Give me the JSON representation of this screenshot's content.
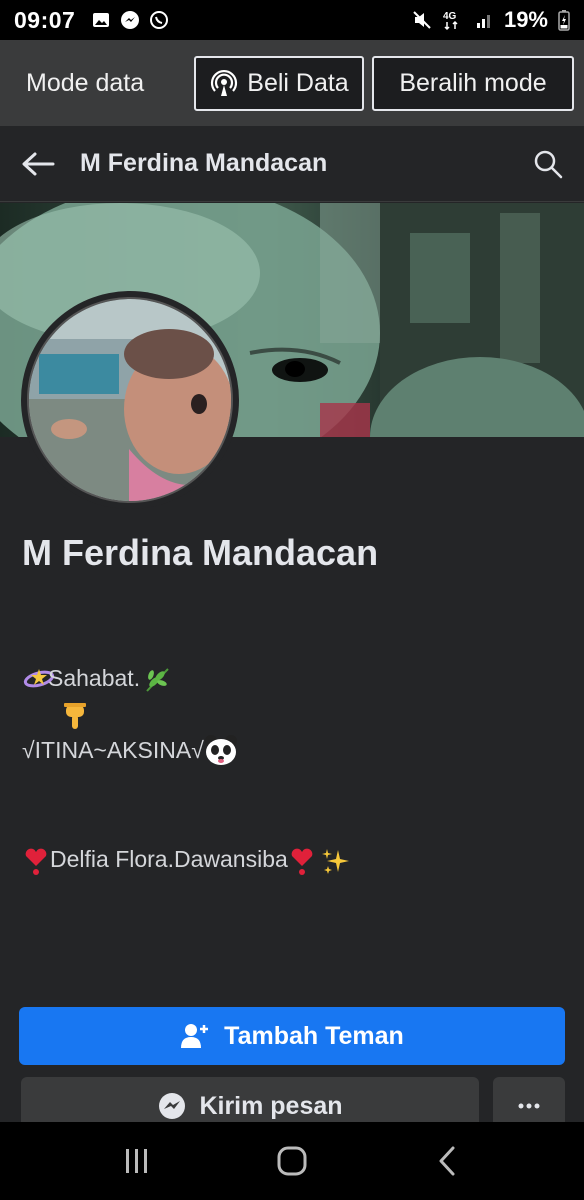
{
  "status_bar": {
    "time": "09:07",
    "battery": "19%",
    "network": "4G",
    "icons_left": [
      "image-icon",
      "messenger-icon",
      "whatsapp-icon"
    ],
    "icons_right": [
      "mute-icon",
      "network-4g-icon",
      "signal-icon",
      "battery-charging-icon"
    ]
  },
  "data_mode": {
    "label": "Mode data",
    "buy_button": "Beli Data",
    "switch_button": "Beralih mode"
  },
  "header": {
    "title": "M Ferdina Mandacan"
  },
  "profile": {
    "name": "M Ferdina Mandacan",
    "bio": {
      "line1": "Sahabat.",
      "line3": "√ITINA~AKSINA√",
      "line4": " Delfia Flora.Dawansiba"
    }
  },
  "actions": {
    "add_friend": "Tambah Teman",
    "message": "Kirim pesan"
  },
  "colors": {
    "accent": "#1877f2",
    "background": "#242527",
    "surface": "#3a3b3c"
  }
}
